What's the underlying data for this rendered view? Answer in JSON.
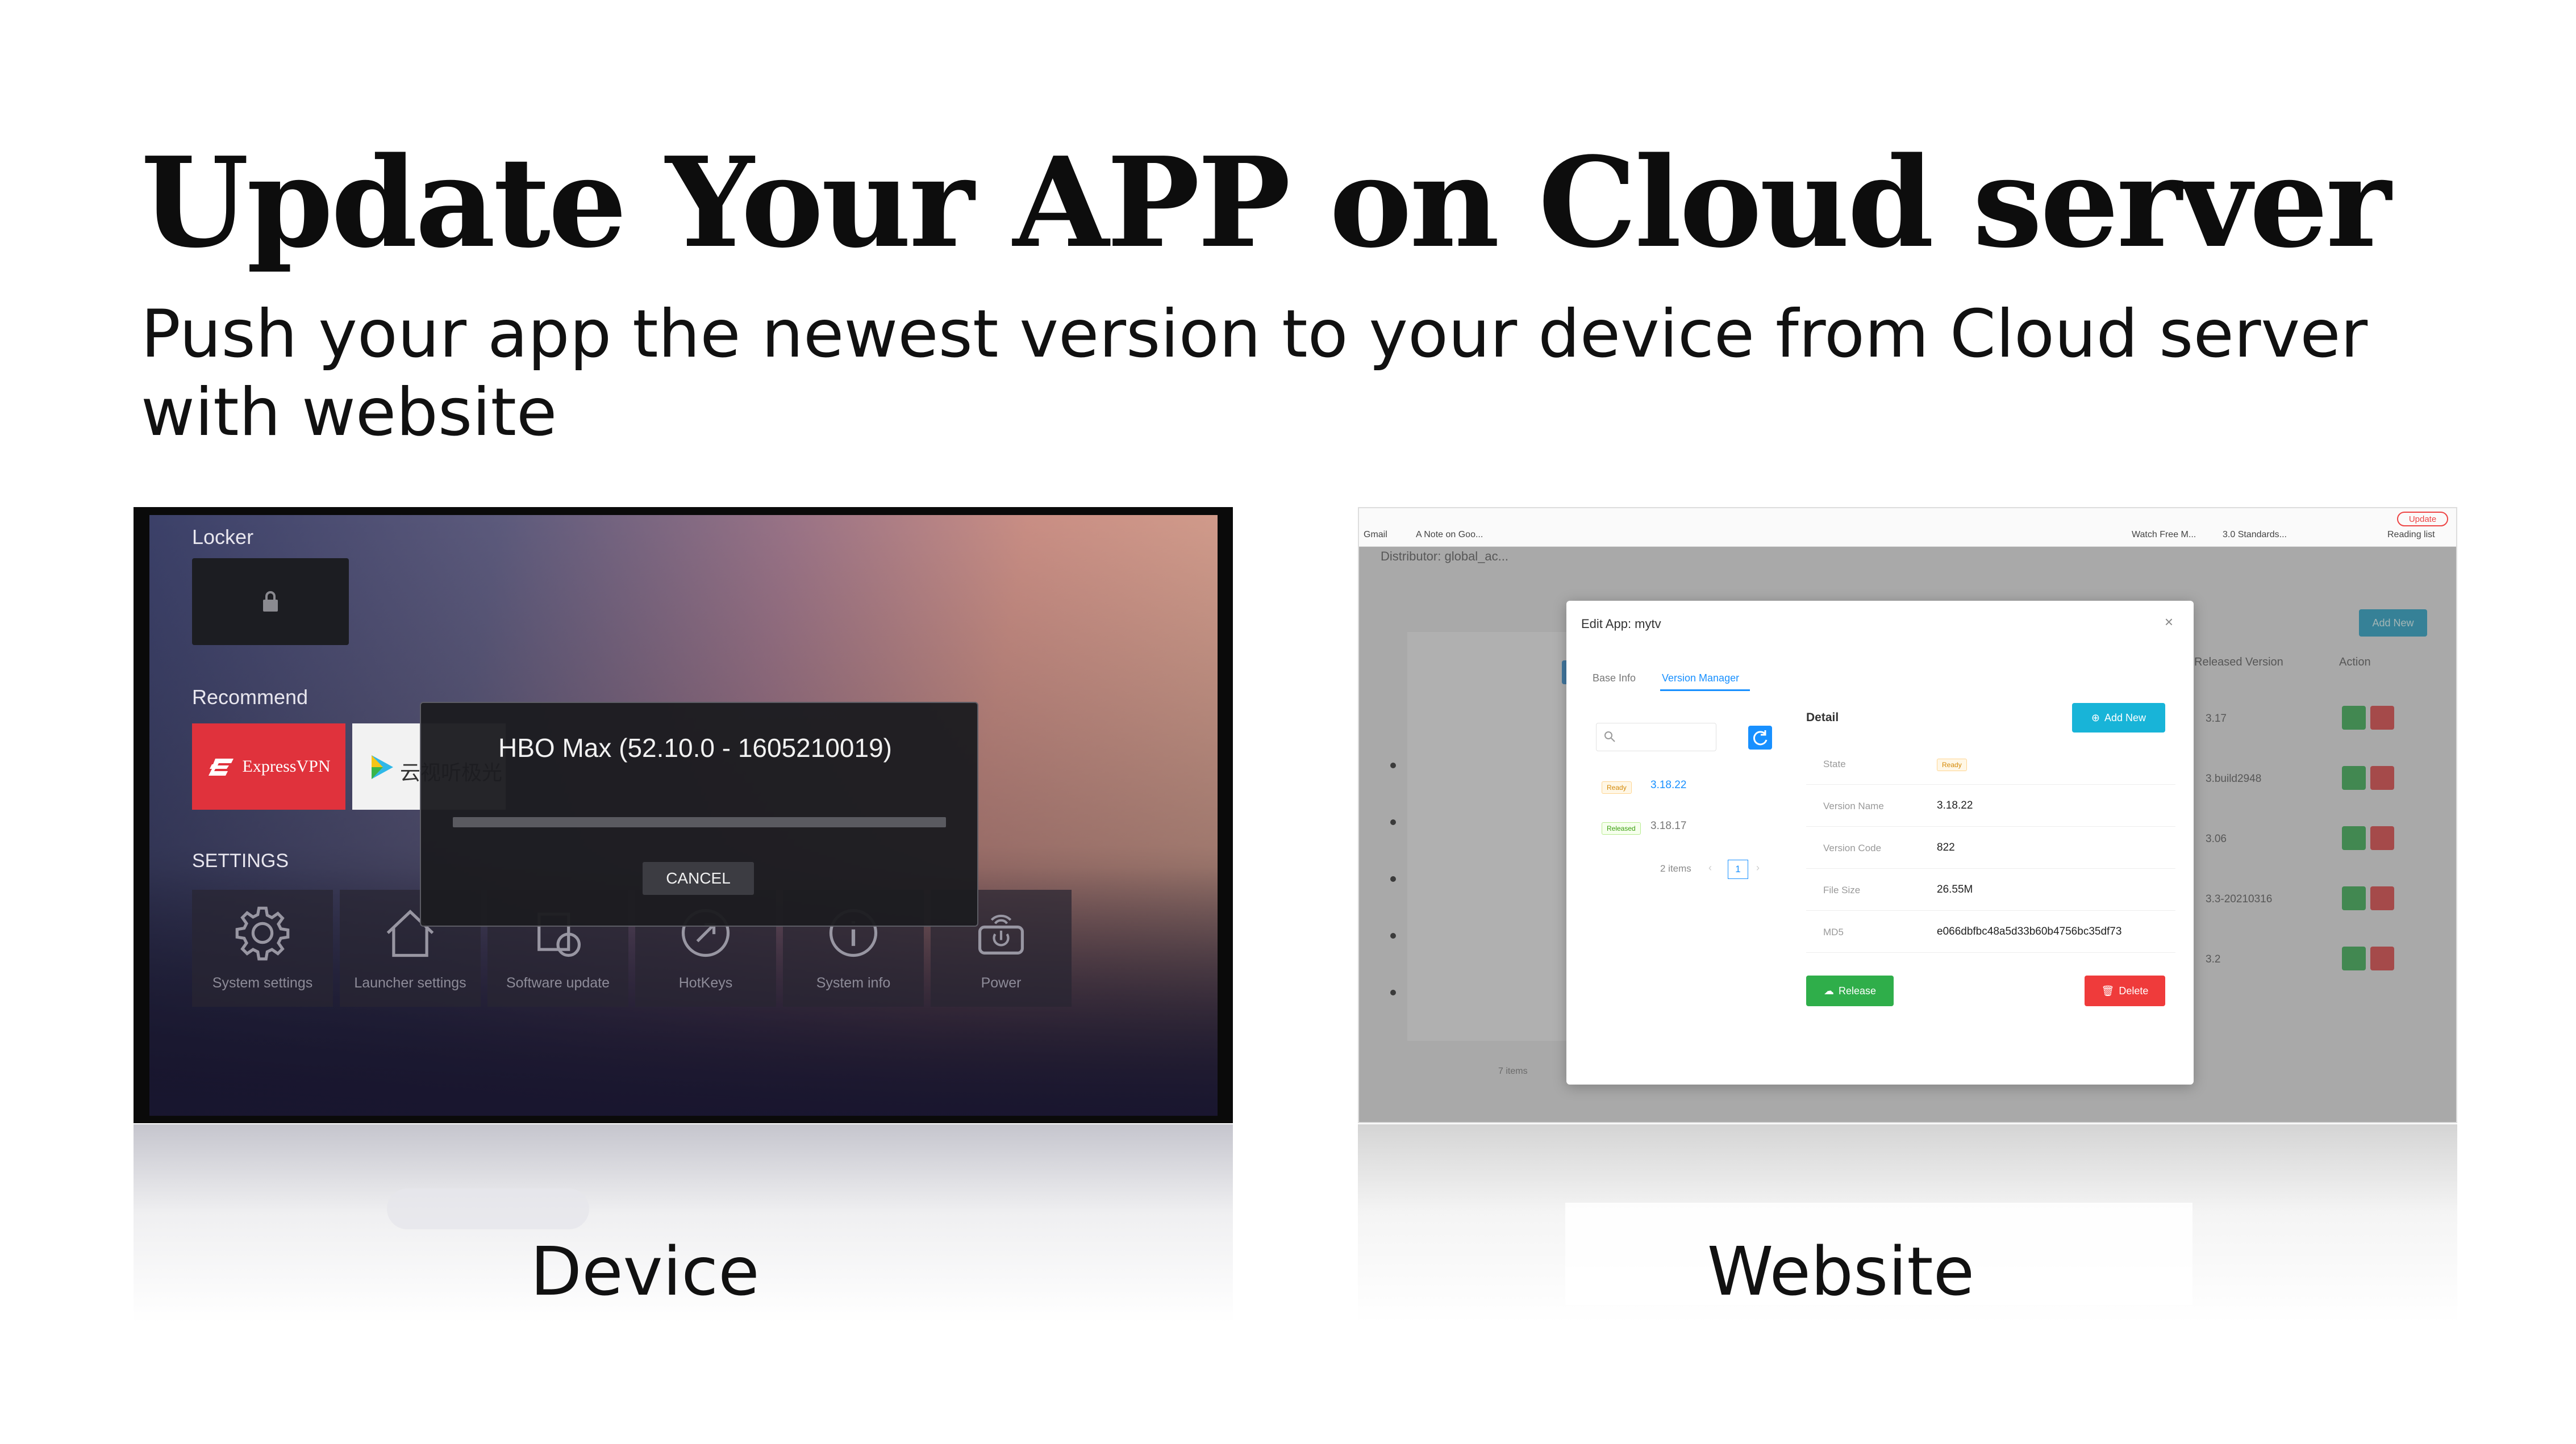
{
  "slide": {
    "title": "Update Your APP on Cloud server",
    "subtitle": "Push your app the newest version to your device from Cloud server with website",
    "captions": {
      "device": "Device",
      "website": "Website"
    }
  },
  "device": {
    "locker_label": "Locker",
    "recommend_label": "Recommend",
    "settings_label": "SETTINGS",
    "apps": [
      {
        "name": "ExpressVPN",
        "icon": "expressvpn-logo",
        "bg": "#e0323c"
      },
      {
        "name": "云视听极光",
        "icon": "play-icon",
        "bg": "#f2f2f2"
      }
    ],
    "settings_items": [
      {
        "label": "System settings",
        "icon": "gear-icon"
      },
      {
        "label": "Launcher settings",
        "icon": "home-icon"
      },
      {
        "label": "Software update",
        "icon": "update-icon"
      },
      {
        "label": "HotKeys",
        "icon": "hotkeys-icon"
      },
      {
        "label": "System info",
        "icon": "info-icon"
      },
      {
        "label": "Power",
        "icon": "power-icon"
      }
    ],
    "dialog": {
      "title": "HBO Max (52.10.0 - 1605210019)",
      "progress": 0.0,
      "cancel_label": "CANCEL"
    }
  },
  "website": {
    "bookmarks": [
      "Gmail",
      "A Note on Goo...",
      "Watch Free M...",
      "3.0 Standards...",
      "Reading list"
    ],
    "update_label": "Update",
    "distributor_text": "Distributor: global_ac...",
    "bg_add_new": "Add New",
    "bg_columns": {
      "released_version": "Released Version",
      "action": "Action"
    },
    "bg_versions": [
      "3.17",
      "3.build2948",
      "3.06",
      "3.3-20210316",
      "3.2"
    ],
    "bg_total": "7 items",
    "modal": {
      "title": "Edit App: mytv",
      "close": "×",
      "tabs": [
        "Base Info",
        "Version Manager"
      ],
      "active_tab": 1,
      "versions": [
        {
          "status": "Ready",
          "version": "3.18.22",
          "link": true
        },
        {
          "status": "Released",
          "version": "3.18.17",
          "link": false
        }
      ],
      "pagination": {
        "total": "2 items",
        "page": "1",
        "prev": "‹",
        "next": "›"
      },
      "detail_label": "Detail",
      "add_new_label": "Add New",
      "details": [
        {
          "key": "State",
          "value": "Ready",
          "tag": true
        },
        {
          "key": "Version Name",
          "value": "3.18.22"
        },
        {
          "key": "Version Code",
          "value": "822"
        },
        {
          "key": "File Size",
          "value": "26.55M"
        },
        {
          "key": "MD5",
          "value": "e066dbfbc48a5d33b60b4756bc35df73"
        }
      ],
      "release_label": "Release",
      "delete_label": "Delete"
    }
  },
  "colors": {
    "primary": "#1890ff",
    "success": "#2fae4a",
    "danger": "#ef3b3b",
    "cyan": "#18b4d8",
    "vpn_red": "#e0323c"
  }
}
